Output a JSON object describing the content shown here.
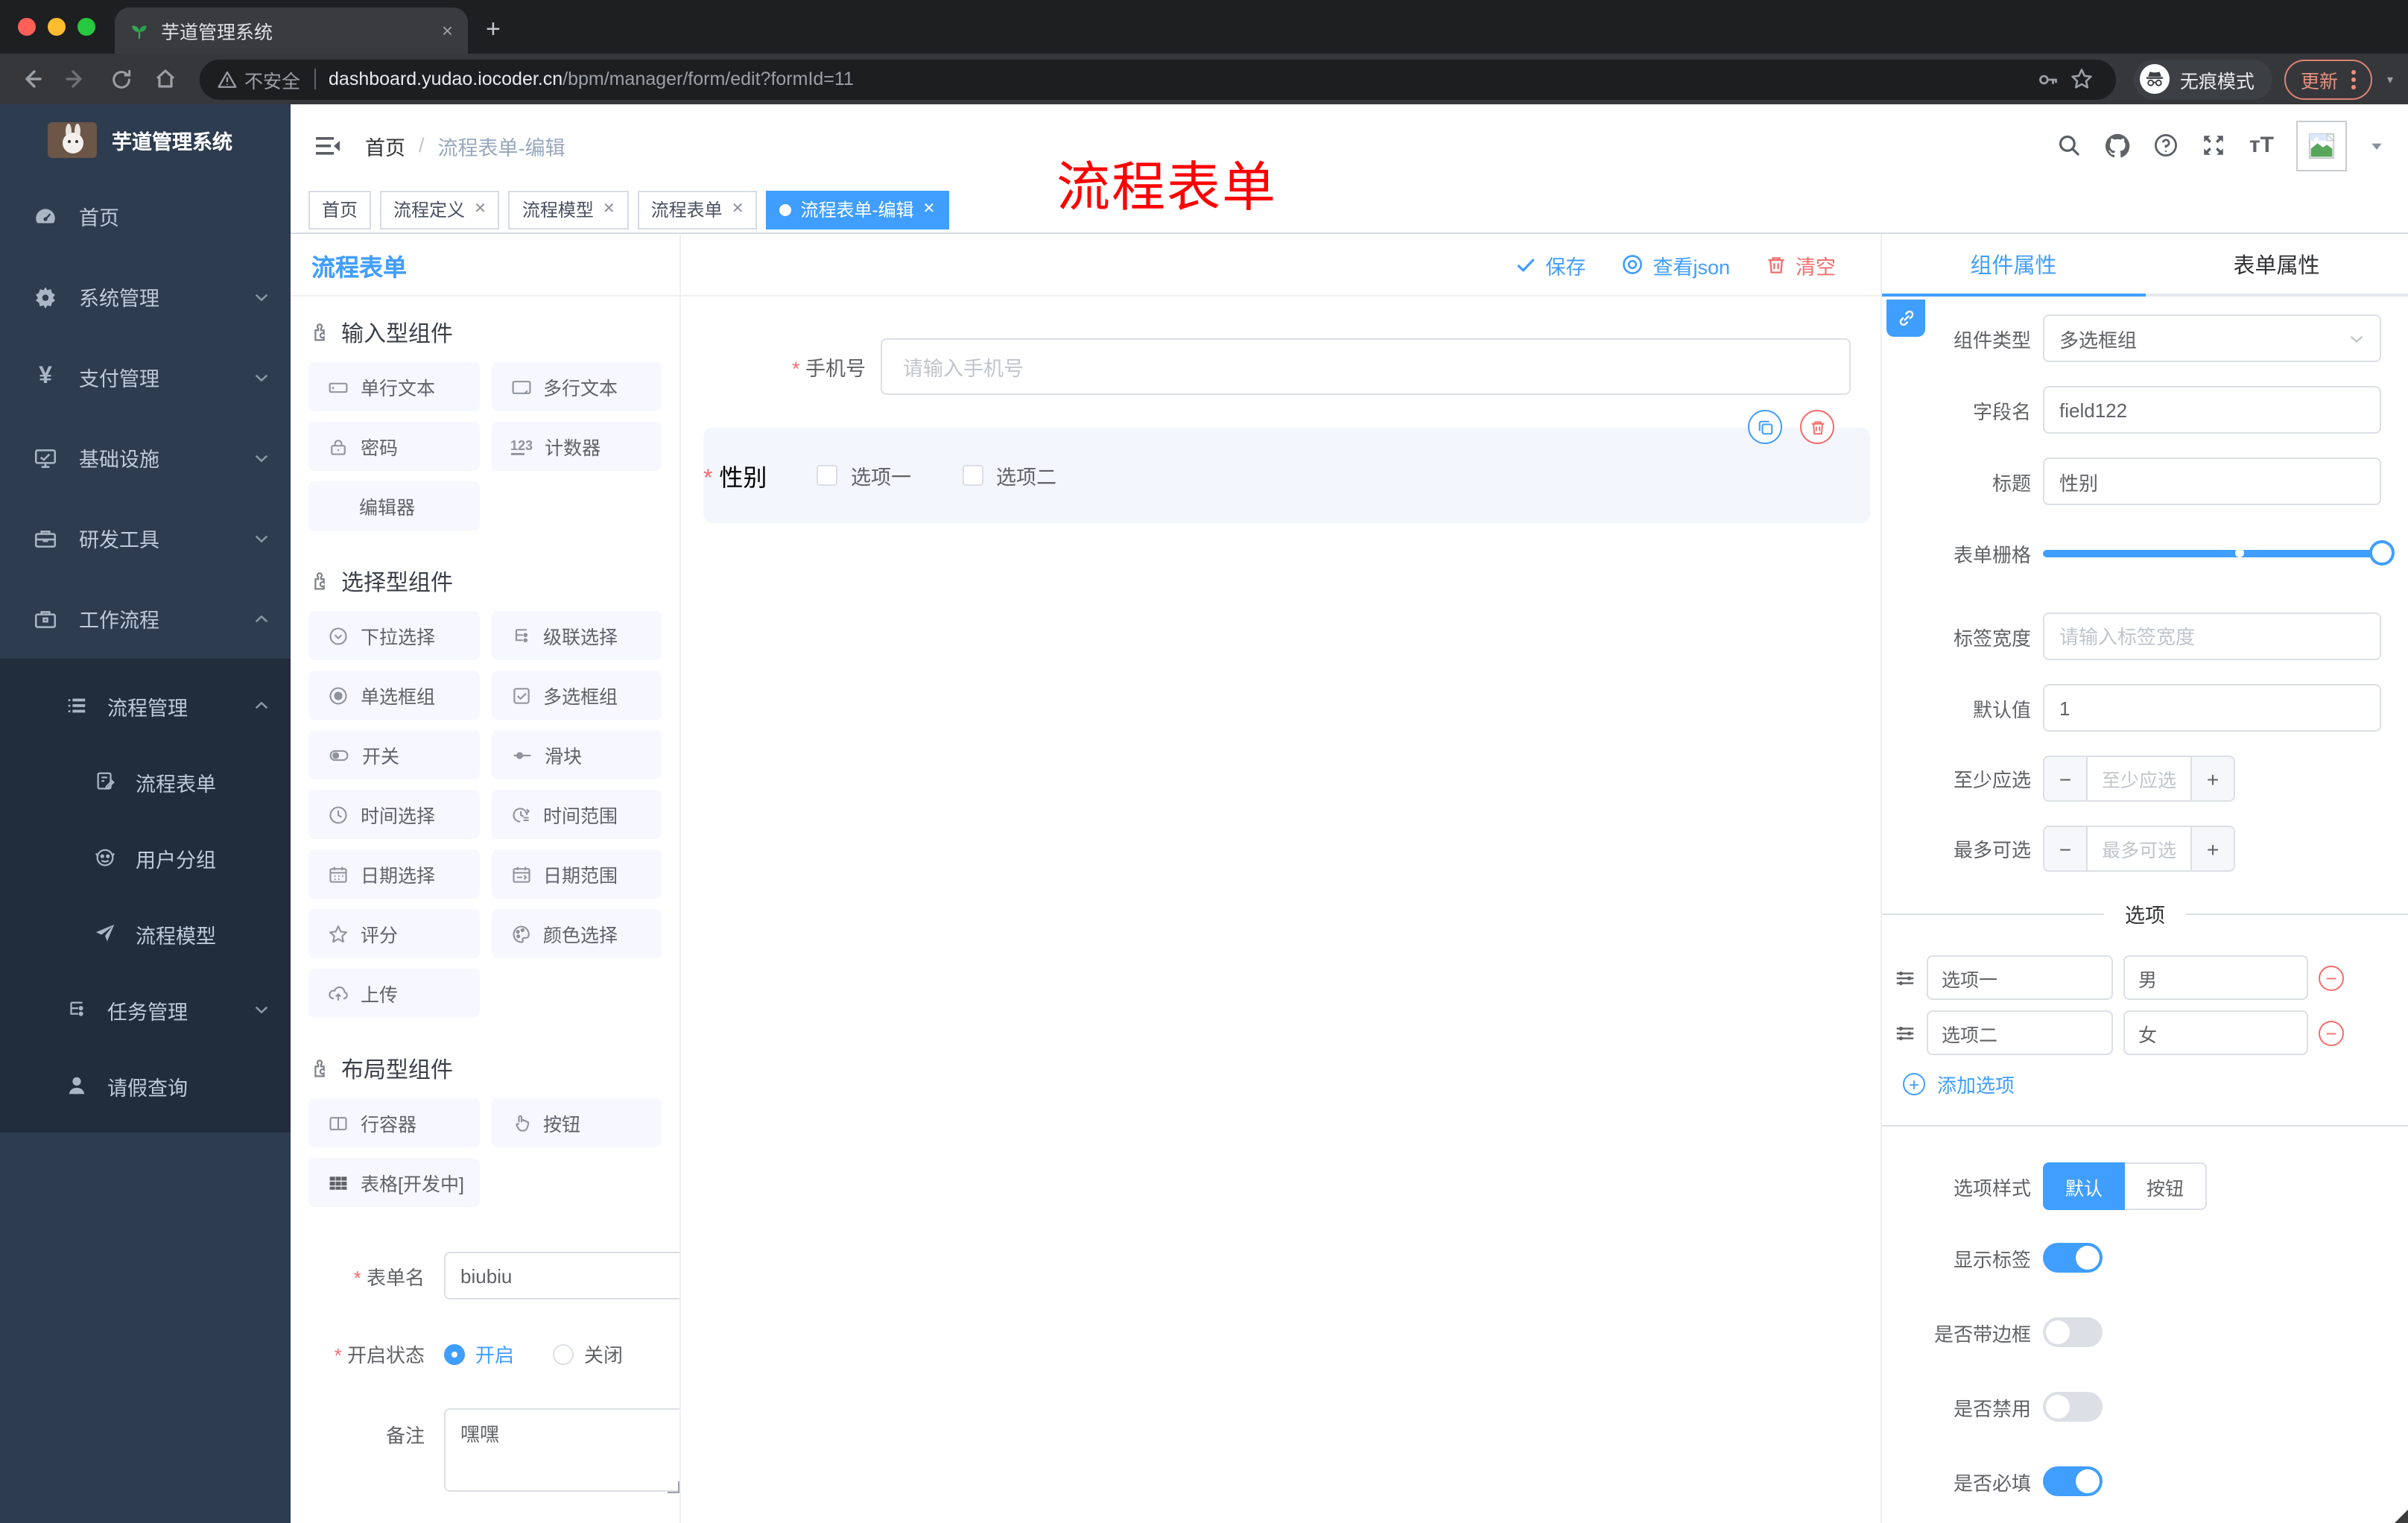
{
  "browser": {
    "tab_title": "芋道管理系统",
    "close_glyph": "×",
    "new_tab_glyph": "+",
    "security_label": "不安全",
    "url_domain": "dashboard.yudao.iocoder.cn",
    "url_path": "/bpm/manager/form/edit?formId=11",
    "incognito_label": "无痕模式",
    "update_label": "更新",
    "colors": {
      "traffic_red": "#ff5f57",
      "traffic_yellow": "#febc2e",
      "traffic_green": "#28c840"
    }
  },
  "sidebar": {
    "app_title": "芋道管理系统",
    "items": [
      {
        "label": "首页",
        "icon": "dashboard-icon",
        "chevron": ""
      },
      {
        "label": "系统管理",
        "icon": "gear-icon",
        "chevron": "down"
      },
      {
        "label": "支付管理",
        "icon": "yen-icon",
        "chevron": "down"
      },
      {
        "label": "基础设施",
        "icon": "monitor-icon",
        "chevron": "down"
      },
      {
        "label": "研发工具",
        "icon": "toolbox-icon",
        "chevron": "down"
      },
      {
        "label": "工作流程",
        "icon": "briefcase-icon",
        "chevron": "up"
      }
    ],
    "sub_items": [
      {
        "label": "流程管理",
        "icon": "list-icon",
        "chevron": "up",
        "level": 2
      },
      {
        "label": "流程表单",
        "icon": "form-doc-icon",
        "level": 3
      },
      {
        "label": "用户分组",
        "icon": "robot-icon",
        "level": 3
      },
      {
        "label": "流程模型",
        "icon": "send-icon",
        "level": 3
      },
      {
        "label": "任务管理",
        "icon": "tree-icon",
        "chevron": "down",
        "level": 2
      },
      {
        "label": "请假查询",
        "icon": "user-icon",
        "level": 2
      }
    ]
  },
  "navbar": {
    "breadcrumb_home": "首页",
    "breadcrumb_sep": "/",
    "breadcrumb_current": "流程表单-编辑",
    "watermark": "流程表单"
  },
  "tags": [
    {
      "label": "首页",
      "closable": false,
      "active": false
    },
    {
      "label": "流程定义",
      "closable": true,
      "active": false
    },
    {
      "label": "流程模型",
      "closable": true,
      "active": false
    },
    {
      "label": "流程表单",
      "closable": true,
      "active": false
    },
    {
      "label": "流程表单-编辑",
      "closable": true,
      "active": true
    }
  ],
  "left_panel": {
    "title": "流程表单",
    "sections": [
      {
        "title": "输入型组件",
        "items": [
          "单行文本",
          "多行文本",
          "密码",
          "计数器",
          "编辑器"
        ]
      },
      {
        "title": "选择型组件",
        "items": [
          "下拉选择",
          "级联选择",
          "单选框组",
          "多选框组",
          "开关",
          "滑块",
          "时间选择",
          "时间范围",
          "日期选择",
          "日期范围",
          "评分",
          "颜色选择",
          "上传"
        ]
      },
      {
        "title": "布局型组件",
        "items": [
          "行容器",
          "按钮",
          "表格[开发中]"
        ]
      }
    ],
    "form": {
      "name_label": "表单名",
      "name_value": "biubiu",
      "status_label": "开启状态",
      "status_on": "开启",
      "status_off": "关闭",
      "remark_label": "备注",
      "remark_value": "嘿嘿"
    }
  },
  "canvas": {
    "save_label": "保存",
    "view_json_label": "查看json",
    "clear_label": "清空",
    "phone_label": "手机号",
    "phone_placeholder": "请输入手机号",
    "gender_label": "性别",
    "gender_options": [
      "选项一",
      "选项二"
    ]
  },
  "right_panel": {
    "tab_component": "组件属性",
    "tab_form": "表单属性",
    "component_type_label": "组件类型",
    "component_type_value": "多选框组",
    "field_name_label": "字段名",
    "field_name_value": "field122",
    "title_label": "标题",
    "title_value": "性别",
    "grid_label": "表单栅格",
    "label_width_label": "标签宽度",
    "label_width_placeholder": "请输入标签宽度",
    "default_label": "默认值",
    "default_value": "1",
    "min_label": "至少应选",
    "min_placeholder": "至少应选",
    "max_label": "最多可选",
    "max_placeholder": "最多可选",
    "stepper_minus": "−",
    "stepper_plus": "+",
    "options_title": "选项",
    "options": [
      {
        "label": "选项一",
        "value": "男"
      },
      {
        "label": "选项二",
        "value": "女"
      }
    ],
    "remove_glyph": "−",
    "add_option_label": "添加选项",
    "style_label": "选项样式",
    "style_default": "默认",
    "style_button": "按钮",
    "toggles": [
      {
        "label": "显示标签",
        "on": true
      },
      {
        "label": "是否带边框",
        "on": false
      },
      {
        "label": "是否禁用",
        "on": false
      },
      {
        "label": "是否必填",
        "on": true
      }
    ],
    "accent_color": "#409eff",
    "danger_color": "#f56c6c"
  }
}
